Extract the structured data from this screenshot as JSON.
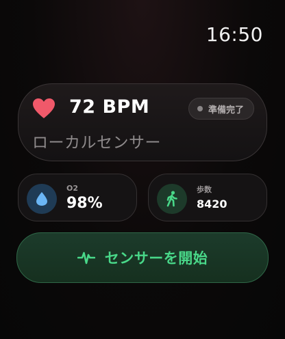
{
  "status_bar": {
    "time": "16:50"
  },
  "heart_rate": {
    "value_text": "72 BPM",
    "status_badge": "準備完了",
    "sensor_name": "ローカルセンサー",
    "icon": "heart-icon",
    "accent_color": "#f0596a"
  },
  "oxygen": {
    "label": "O2",
    "value": "98%",
    "icon": "water-drop-icon",
    "accent_color": "#6bb6f5"
  },
  "steps": {
    "label": "歩数",
    "value": "8420",
    "icon": "walking-person-icon",
    "accent_color": "#49d889"
  },
  "start_button": {
    "label": "センサーを開始",
    "icon": "pulse-icon",
    "accent_color": "#49d889"
  }
}
